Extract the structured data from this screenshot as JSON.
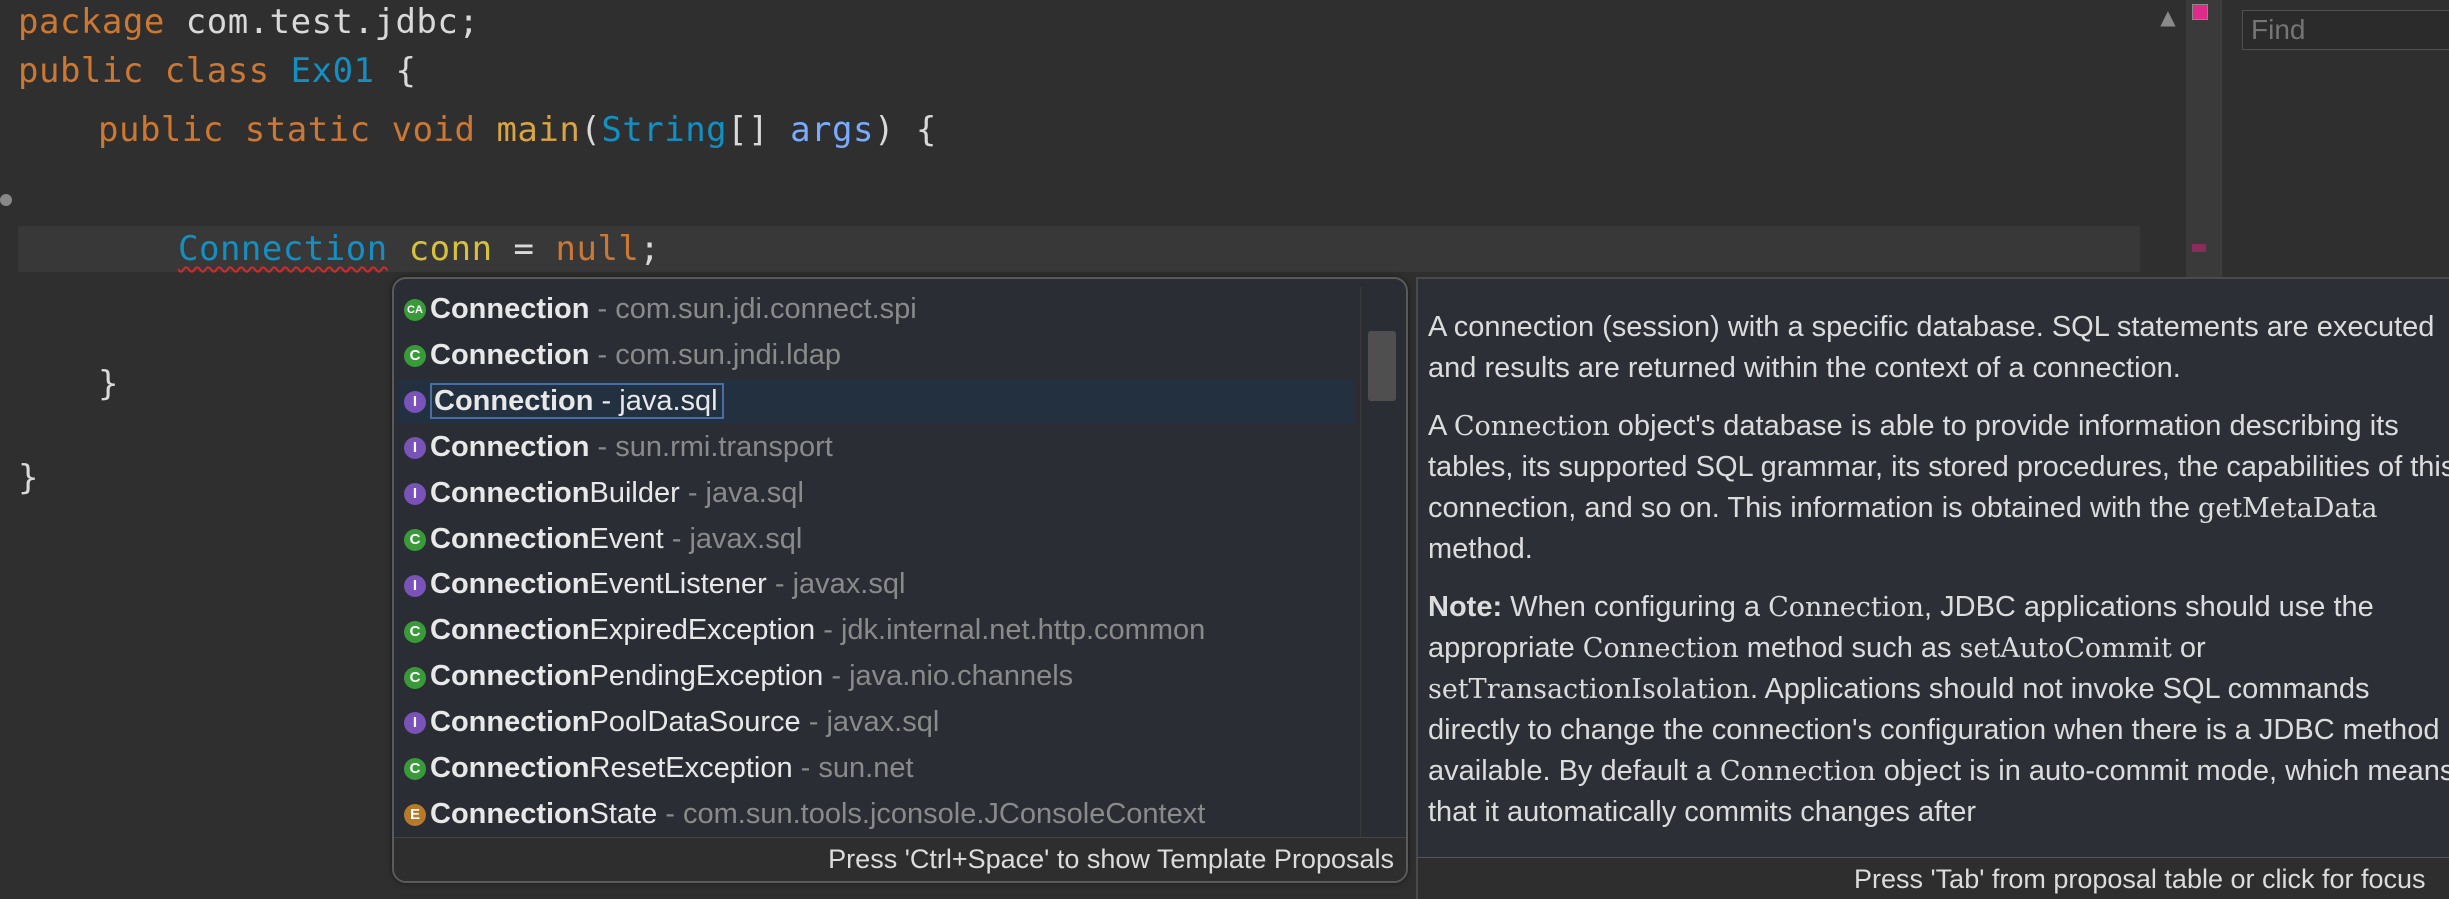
{
  "editor": {
    "lines": {
      "package_kw": "package",
      "package_name": " com.test.jdbc;",
      "public1": "public",
      "class_kw": " class ",
      "class_name": "Ex01",
      "class_open": " {",
      "public2": "public",
      "static_kw": " static",
      "void_kw": " void",
      "method_name": " main",
      "paren_open": "(",
      "string_type": "String",
      "array_brackets": "[] ",
      "args_param": "args",
      "method_sig_end": ") {",
      "conn_type": "Connection",
      "conn_var": "conn",
      "assign": " = ",
      "null_kw": "null",
      "semicolon": ";",
      "method_close": "}",
      "class_close": "}"
    },
    "scroll_up_glyph": "▲"
  },
  "side_panel": {
    "find_placeholder": "Find"
  },
  "completion": {
    "proposals": [
      {
        "icon": "CA",
        "bold": "Connection",
        "rest": "",
        "pkg": " - com.sun.jdi.connect.spi"
      },
      {
        "icon": "C",
        "bold": "Connection",
        "rest": "",
        "pkg": " - com.sun.jndi.ldap"
      },
      {
        "icon": "I",
        "bold": "Connection",
        "rest": "",
        "pkg": " - java.sql"
      },
      {
        "icon": "I",
        "bold": "Connection",
        "rest": "",
        "pkg": " - sun.rmi.transport"
      },
      {
        "icon": "I",
        "bold": "Connection",
        "rest": "Builder",
        "pkg": " - java.sql"
      },
      {
        "icon": "C",
        "bold": "Connection",
        "rest": "Event",
        "pkg": " - javax.sql"
      },
      {
        "icon": "I",
        "bold": "Connection",
        "rest": "EventListener",
        "pkg": " - javax.sql"
      },
      {
        "icon": "C",
        "bold": "Connection",
        "rest": "ExpiredException",
        "pkg": " - jdk.internal.net.http.common"
      },
      {
        "icon": "C",
        "bold": "Connection",
        "rest": "PendingException",
        "pkg": " - java.nio.channels"
      },
      {
        "icon": "I",
        "bold": "Connection",
        "rest": "PoolDataSource",
        "pkg": " - javax.sql"
      },
      {
        "icon": "C",
        "bold": "Connection",
        "rest": "ResetException",
        "pkg": " - sun.net"
      },
      {
        "icon": "E",
        "bold": "Connection",
        "rest": "State",
        "pkg": " - com.sun.tools.jconsole.JConsoleContext"
      }
    ],
    "selected_index": 2,
    "status": "Press 'Ctrl+Space' to show Template Proposals"
  },
  "doc": {
    "p1": "A connection (session) with a specific database. SQL statements are executed and results are returned within the context of a connection.",
    "p2_a": "A ",
    "p2_code1": "Connection",
    "p2_b": " object's database is able to provide information describing its tables, its supported SQL grammar, its stored procedures, the capabilities of this connection, and so on. This information is obtained with the ",
    "p2_code2": "getMetaData",
    "p2_c": " method.",
    "p3_note": "Note:",
    "p3_a": " When configuring a ",
    "p3_code1": "Connection",
    "p3_b": ", JDBC applications should use the appropriate ",
    "p3_code2": "Connection",
    "p3_c": " method such as ",
    "p3_code3": "setAutoCommit",
    "p3_d": " or ",
    "p3_code4": "setTransactionIsolation",
    "p3_e": ". Applications should not invoke SQL commands directly to change the connection's configuration when there is a JDBC method available. By default a ",
    "p3_code5": "Connection",
    "p3_f": " object is in auto-commit mode, which means that it automatically commits changes after",
    "status": "Press 'Tab' from proposal table or click for focus"
  }
}
